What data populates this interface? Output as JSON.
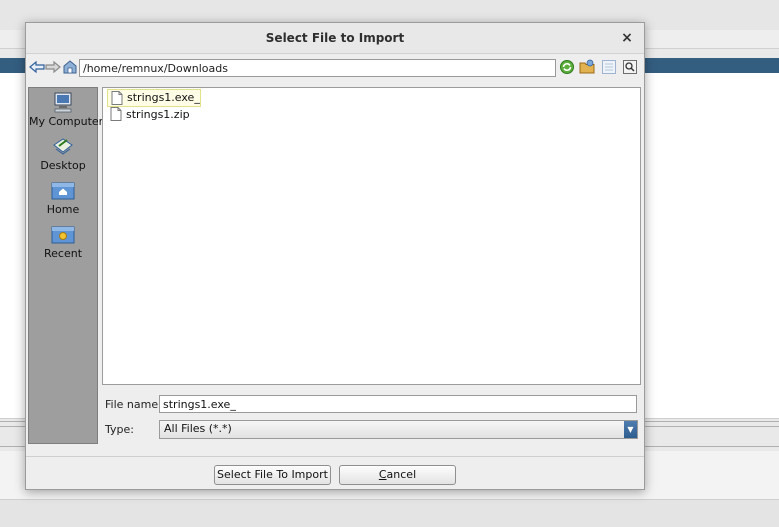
{
  "dialog": {
    "title": "Select File to Import",
    "close_label": "×"
  },
  "toolbar": {
    "back_icon": "back-arrow-icon",
    "forward_icon": "forward-arrow-icon",
    "up_icon": "up-folder-icon",
    "path": "/home/remnux/Downloads",
    "refresh_icon": "refresh-icon",
    "new_folder_icon": "new-folder-icon",
    "list_view_icon": "list-view-icon",
    "details_view_icon": "details-view-icon"
  },
  "sidebar": {
    "items": [
      {
        "label": "My Computer",
        "icon": "computer-icon"
      },
      {
        "label": "Desktop",
        "icon": "desktop-icon"
      },
      {
        "label": "Home",
        "icon": "home-icon"
      },
      {
        "label": "Recent",
        "icon": "recent-icon"
      }
    ]
  },
  "files": [
    {
      "name": "strings1.exe_",
      "selected": true,
      "icon": "file-icon"
    },
    {
      "name": "strings1.zip",
      "selected": false,
      "icon": "file-icon"
    }
  ],
  "form": {
    "file_name_label": "File name:",
    "file_name_value": "strings1.exe_",
    "type_label": "Type:",
    "type_value": "All Files (*.*)"
  },
  "buttons": {
    "import_label": "Select File To Import",
    "cancel_mnemonic": "C",
    "cancel_rest": "ancel"
  },
  "colors": {
    "background_band": "#345e80",
    "sidebar": "#9e9e9e",
    "selection_highlight": "#fffde6",
    "dropdown_arrow": "#3a6a9e"
  }
}
